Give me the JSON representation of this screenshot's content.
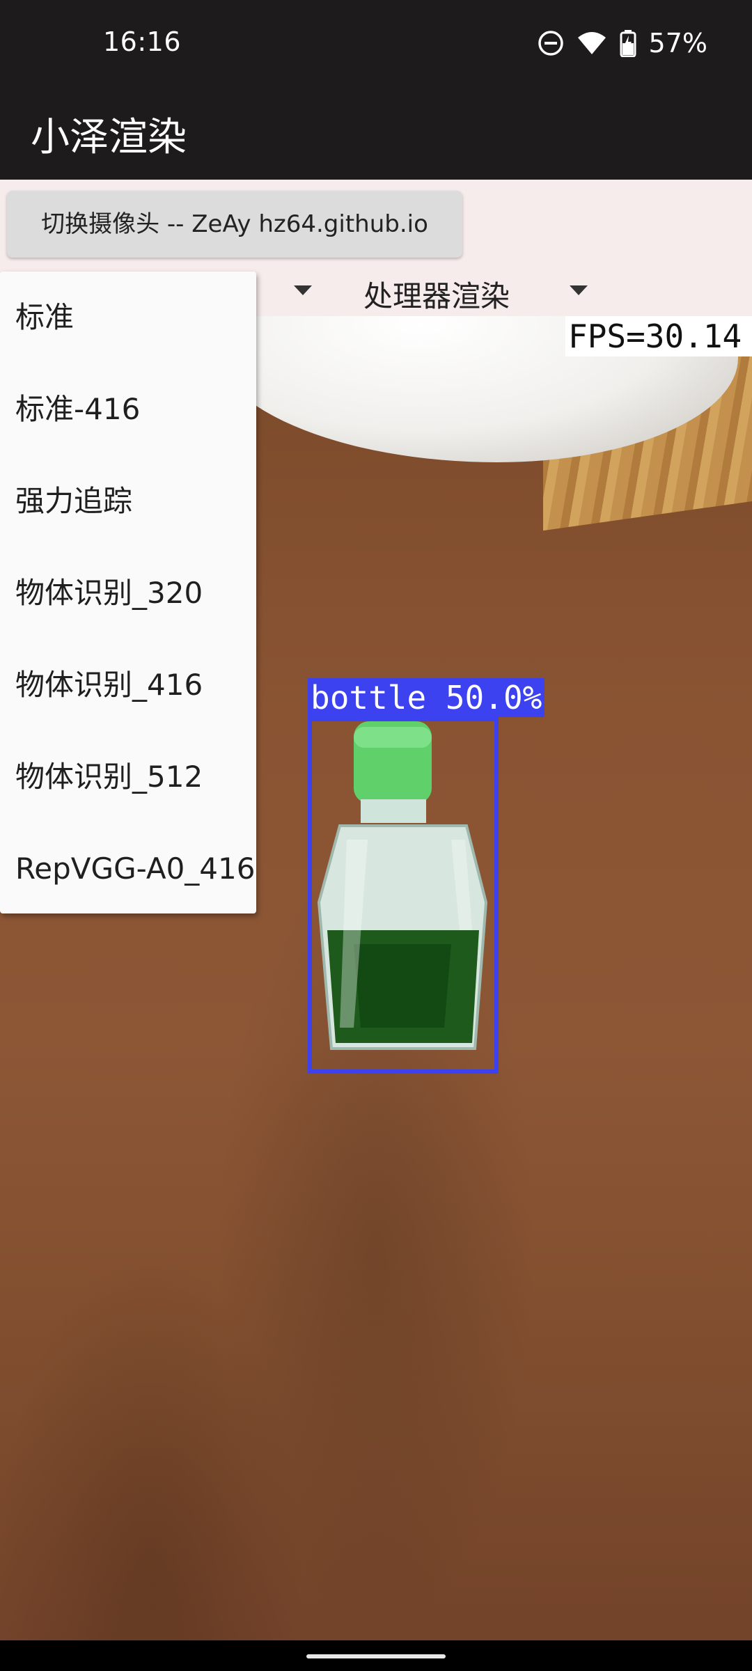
{
  "status_bar": {
    "time": "16:16",
    "battery_percent": "57%",
    "icons": [
      "do-not-disturb-icon",
      "wifi-icon",
      "battery-charging-icon"
    ]
  },
  "app_bar": {
    "title": "小泽渲染"
  },
  "controls": {
    "switch_camera_label": "切换摄像头 -- ZeAy hz64.github.io",
    "render_spinner_value": "处理器渲染"
  },
  "model_menu": {
    "items": [
      "标准",
      "标准-416",
      "强力追踪",
      "物体识别_320",
      "物体识别_416",
      "物体识别_512",
      "RepVGG-A0_416"
    ]
  },
  "camera": {
    "fps_text": "FPS=30.14",
    "detections": [
      {
        "label": "bottle 50.0%",
        "color": "#3d42f0"
      }
    ]
  },
  "colors": {
    "status_bar_bg": "#1e1b1c",
    "controls_bg": "#f7ecec",
    "detection_color": "#3d42f0"
  }
}
